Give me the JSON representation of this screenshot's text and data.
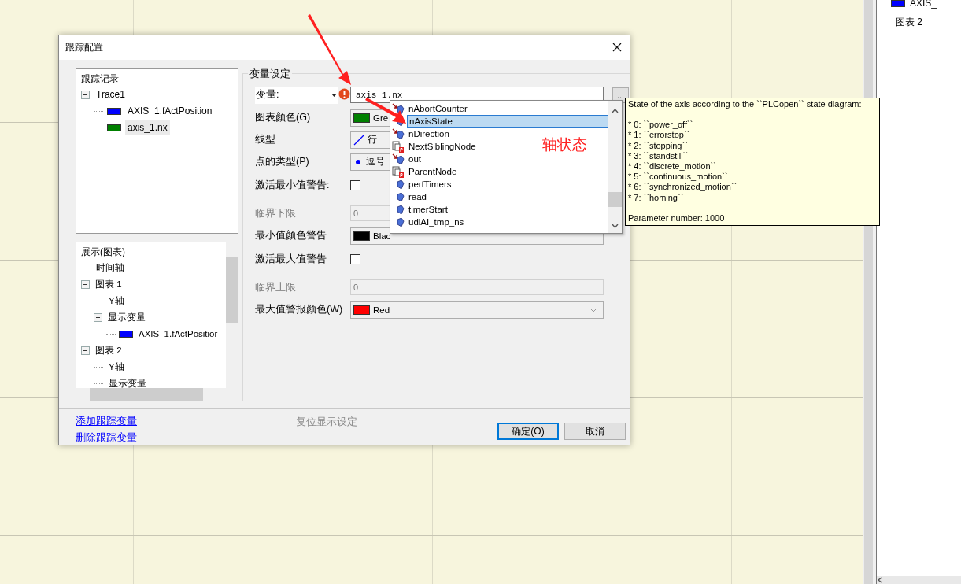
{
  "side_tree": [
    {
      "label": "AXIS_",
      "color": "#0000ff"
    },
    {
      "label": "图表 2"
    }
  ],
  "dialog": {
    "title": "跟踪配置",
    "trace_tree": {
      "header": "跟踪记录",
      "items": [
        {
          "label": "Trace1",
          "expanded": true,
          "children": [
            {
              "label": "AXIS_1.fActPosition",
              "color": "#0000ff",
              "selected": false
            },
            {
              "label": "axis_1.nx",
              "color": "#008000",
              "selected": true
            }
          ]
        }
      ]
    },
    "display_tree": {
      "header": "展示(图表)",
      "items": [
        {
          "label": "时间轴"
        },
        {
          "label": "图表 1",
          "expanded": true,
          "children": [
            {
              "label": "Y轴"
            },
            {
              "label": "显示变量",
              "expanded": true,
              "children": [
                {
                  "label": "AXIS_1.fActPositior",
                  "color": "#0000ff"
                }
              ]
            }
          ]
        },
        {
          "label": "图表 2",
          "expanded": true,
          "children": [
            {
              "label": "Y轴"
            },
            {
              "label": "显示变量"
            }
          ]
        }
      ]
    },
    "group": {
      "title": "变量设定",
      "rows": [
        {
          "kind": "variable",
          "label": "变量:",
          "value": "axis_1.nx",
          "error": true,
          "browse": "..."
        },
        {
          "kind": "color",
          "label": "图表颜色(G)",
          "color": "#008000",
          "value": "Gre"
        },
        {
          "kind": "line",
          "label": "线型",
          "value": "行"
        },
        {
          "kind": "point",
          "label": "点的类型(P)",
          "value": "逗号"
        },
        {
          "kind": "checkbox",
          "label": "激活最小值警告:",
          "checked": false
        },
        {
          "kind": "number",
          "label": "临界下限",
          "value": "0",
          "disabled": true
        },
        {
          "kind": "color",
          "label": "最小值颜色警告",
          "color": "#000000",
          "value": "Blac"
        },
        {
          "kind": "checkbox",
          "label": "激活最大值警告",
          "checked": false
        },
        {
          "kind": "number",
          "label": "临界上限",
          "value": "0",
          "disabled": true
        },
        {
          "kind": "color",
          "label": "最大值警报颜色(W)",
          "color": "#ff0000",
          "value": "Red",
          "arrow": true
        }
      ]
    },
    "links": [
      "添加跟踪变量",
      "删除跟踪变量"
    ],
    "reset": {
      "label": "复位显示设定",
      "disabled": true
    },
    "buttons": [
      {
        "label": "确定(O)",
        "default": true
      },
      {
        "label": "取消",
        "default": false
      }
    ]
  },
  "autocomplete": {
    "items": [
      {
        "kind": "input",
        "label": "nAbortCounter",
        "selected": false
      },
      {
        "kind": "variable",
        "label": "nAxisState",
        "selected": true
      },
      {
        "kind": "input",
        "label": "nDirection",
        "selected": false
      },
      {
        "kind": "property",
        "label": "NextSiblingNode",
        "selected": false
      },
      {
        "kind": "input",
        "label": "out",
        "selected": false
      },
      {
        "kind": "property",
        "label": "ParentNode",
        "selected": false
      },
      {
        "kind": "variable",
        "label": "perfTimers",
        "selected": false
      },
      {
        "kind": "variable",
        "label": "read",
        "selected": false
      },
      {
        "kind": "variable",
        "label": "timerStart",
        "selected": false
      },
      {
        "kind": "variable",
        "label": "udiAI_tmp_ns",
        "selected": false
      }
    ]
  },
  "tooltip": {
    "heading": "State of the axis according to the ``PLCopen`` state diagram:",
    "lines": [
      "* 0: ``power_off``",
      "* 1: ``errorstop``",
      "* 2: ``stopping``",
      "* 3: ``standstill``",
      "* 4: ``discrete_motion``",
      "* 5: ``continuous_motion``",
      "* 6: ``synchronized_motion``",
      "* 7: ``homing``"
    ],
    "footer": "Parameter number: 1000"
  },
  "annotation": {
    "text": "轴状态",
    "color": "#ff2020"
  }
}
